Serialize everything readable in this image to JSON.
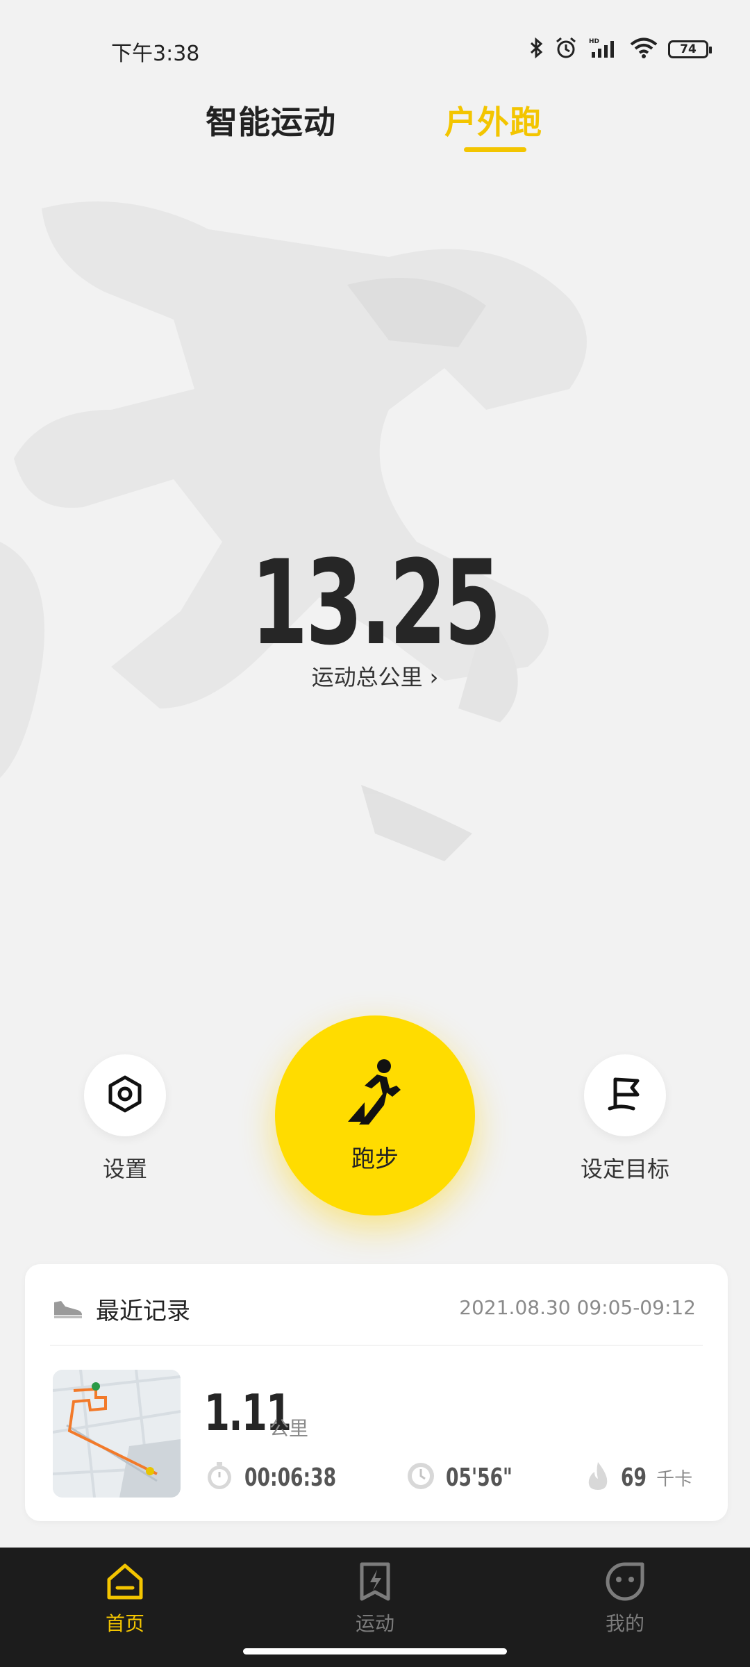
{
  "status_bar": {
    "time": "下午3:38",
    "battery": "74",
    "icons": [
      "bluetooth-icon",
      "alarm-icon",
      "signal-icon",
      "wifi-icon",
      "battery-icon"
    ]
  },
  "tabs": {
    "smart": "智能运动",
    "outdoor": "户外跑",
    "active": "outdoor"
  },
  "hero": {
    "total_value": "13.25",
    "total_label": "运动总公里",
    "chevron": "›"
  },
  "actions": {
    "settings": "设置",
    "run": "跑步",
    "goal": "设定目标"
  },
  "recent": {
    "title": "最近记录",
    "date": "2021.08.30  09:05-09:12",
    "distance": "1.11",
    "distance_unit": "公里",
    "duration": "00:06:38",
    "pace": "05'56\"",
    "calories": "69",
    "calories_unit": "千卡"
  },
  "nav": {
    "home": "首页",
    "sport": "运动",
    "me": "我的",
    "active": "home"
  },
  "colors": {
    "accent": "#f3c500",
    "run_button": "#ffdc00",
    "nav_bg": "#1c1c1c",
    "background": "#f2f2f2"
  }
}
